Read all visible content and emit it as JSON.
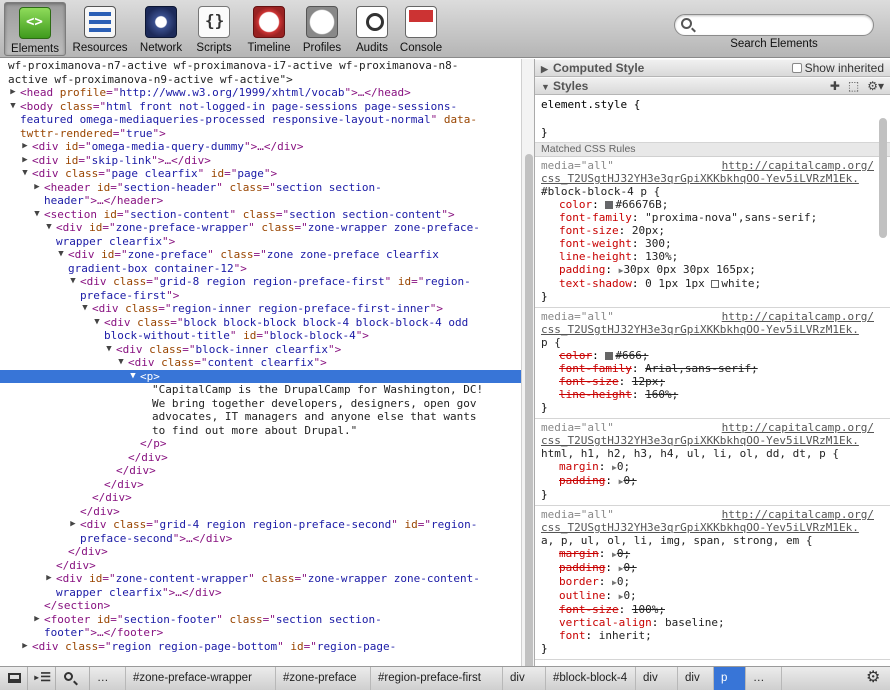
{
  "toolbar": {
    "tabs": [
      {
        "label": "Elements",
        "icon": "elements-icon",
        "selected": true
      },
      {
        "label": "Resources",
        "icon": "resources-icon"
      },
      {
        "label": "Network",
        "icon": "network-icon"
      },
      {
        "label": "Scripts",
        "icon": "scripts-icon"
      },
      {
        "label": "Timeline",
        "icon": "timeline-icon"
      },
      {
        "label": "Profiles",
        "icon": "profiles-icon"
      },
      {
        "label": "Audits",
        "icon": "audits-icon"
      },
      {
        "label": "Console",
        "icon": "console-icon"
      }
    ],
    "search_label": "Search Elements",
    "search_placeholder": ""
  },
  "dom_tree": [
    {
      "indent": 0,
      "tri": "",
      "parts": [
        [
          "tx",
          "wf-proximanova-n7-active wf-proximanova-i7-active wf-proximanova-n8-"
        ]
      ]
    },
    {
      "indent": 0,
      "tri": "",
      "parts": [
        [
          "tx",
          "active wf-proximanova-n9-active wf-active\">"
        ]
      ]
    },
    {
      "indent": 1,
      "tri": "▶",
      "parts": [
        [
          "tn",
          "<head "
        ],
        [
          "an",
          "profile"
        ],
        [
          "tn",
          "=\""
        ],
        [
          "av",
          "http://www.w3.org/1999/xhtml/vocab"
        ],
        [
          "tn",
          "\">…</head>"
        ]
      ]
    },
    {
      "indent": 1,
      "tri": "▼",
      "parts": [
        [
          "tn",
          "<body "
        ],
        [
          "an",
          "class"
        ],
        [
          "tn",
          "=\""
        ],
        [
          "av",
          "html front not-logged-in page-sessions page-sessions-"
        ]
      ]
    },
    {
      "indent": 1,
      "tri": "",
      "parts": [
        [
          "av",
          "featured omega-mediaqueries-processed responsive-layout-normal"
        ],
        [
          "tn",
          "\" "
        ],
        [
          "an",
          "data-"
        ]
      ]
    },
    {
      "indent": 1,
      "tri": "",
      "parts": [
        [
          "an",
          "twttr-rendered"
        ],
        [
          "tn",
          "=\""
        ],
        [
          "av",
          "true"
        ],
        [
          "tn",
          "\">"
        ]
      ]
    },
    {
      "indent": 2,
      "tri": "▶",
      "parts": [
        [
          "tn",
          "<div "
        ],
        [
          "an",
          "id"
        ],
        [
          "tn",
          "=\""
        ],
        [
          "av",
          "omega-media-query-dummy"
        ],
        [
          "tn",
          "\">…</div>"
        ]
      ]
    },
    {
      "indent": 2,
      "tri": "▶",
      "parts": [
        [
          "tn",
          "<div "
        ],
        [
          "an",
          "id"
        ],
        [
          "tn",
          "=\""
        ],
        [
          "av",
          "skip-link"
        ],
        [
          "tn",
          "\">…</div>"
        ]
      ]
    },
    {
      "indent": 2,
      "tri": "▼",
      "parts": [
        [
          "tn",
          "<div "
        ],
        [
          "an",
          "class"
        ],
        [
          "tn",
          "=\""
        ],
        [
          "av",
          "page clearfix"
        ],
        [
          "tn",
          "\" "
        ],
        [
          "an",
          "id"
        ],
        [
          "tn",
          "=\""
        ],
        [
          "av",
          "page"
        ],
        [
          "tn",
          "\">"
        ]
      ]
    },
    {
      "indent": 3,
      "tri": "▶",
      "parts": [
        [
          "tn",
          "<header "
        ],
        [
          "an",
          "id"
        ],
        [
          "tn",
          "=\""
        ],
        [
          "av",
          "section-header"
        ],
        [
          "tn",
          "\" "
        ],
        [
          "an",
          "class"
        ],
        [
          "tn",
          "=\""
        ],
        [
          "av",
          "section section-"
        ]
      ]
    },
    {
      "indent": 3,
      "tri": "",
      "parts": [
        [
          "av",
          "header"
        ],
        [
          "tn",
          "\">…</header>"
        ]
      ]
    },
    {
      "indent": 3,
      "tri": "▼",
      "parts": [
        [
          "tn",
          "<section "
        ],
        [
          "an",
          "id"
        ],
        [
          "tn",
          "=\""
        ],
        [
          "av",
          "section-content"
        ],
        [
          "tn",
          "\" "
        ],
        [
          "an",
          "class"
        ],
        [
          "tn",
          "=\""
        ],
        [
          "av",
          "section section-content"
        ],
        [
          "tn",
          "\">"
        ]
      ]
    },
    {
      "indent": 4,
      "tri": "▼",
      "parts": [
        [
          "tn",
          "<div "
        ],
        [
          "an",
          "id"
        ],
        [
          "tn",
          "=\""
        ],
        [
          "av",
          "zone-preface-wrapper"
        ],
        [
          "tn",
          "\" "
        ],
        [
          "an",
          "class"
        ],
        [
          "tn",
          "=\""
        ],
        [
          "av",
          "zone-wrapper zone-preface-"
        ]
      ]
    },
    {
      "indent": 4,
      "tri": "",
      "parts": [
        [
          "av",
          "wrapper clearfix"
        ],
        [
          "tn",
          "\">"
        ]
      ]
    },
    {
      "indent": 5,
      "tri": "▼",
      "parts": [
        [
          "tn",
          "<div "
        ],
        [
          "an",
          "id"
        ],
        [
          "tn",
          "=\""
        ],
        [
          "av",
          "zone-preface"
        ],
        [
          "tn",
          "\" "
        ],
        [
          "an",
          "class"
        ],
        [
          "tn",
          "=\""
        ],
        [
          "av",
          "zone zone-preface clearfix"
        ]
      ]
    },
    {
      "indent": 5,
      "tri": "",
      "parts": [
        [
          "av",
          "gradient-box container-12"
        ],
        [
          "tn",
          "\">"
        ]
      ]
    },
    {
      "indent": 6,
      "tri": "▼",
      "parts": [
        [
          "tn",
          "<div "
        ],
        [
          "an",
          "class"
        ],
        [
          "tn",
          "=\""
        ],
        [
          "av",
          "grid-8 region region-preface-first"
        ],
        [
          "tn",
          "\" "
        ],
        [
          "an",
          "id"
        ],
        [
          "tn",
          "=\""
        ],
        [
          "av",
          "region-"
        ]
      ]
    },
    {
      "indent": 6,
      "tri": "",
      "parts": [
        [
          "av",
          "preface-first"
        ],
        [
          "tn",
          "\">"
        ]
      ]
    },
    {
      "indent": 7,
      "tri": "▼",
      "parts": [
        [
          "tn",
          "<div "
        ],
        [
          "an",
          "class"
        ],
        [
          "tn",
          "=\""
        ],
        [
          "av",
          "region-inner region-preface-first-inner"
        ],
        [
          "tn",
          "\">"
        ]
      ]
    },
    {
      "indent": 8,
      "tri": "▼",
      "parts": [
        [
          "tn",
          "<div "
        ],
        [
          "an",
          "class"
        ],
        [
          "tn",
          "=\""
        ],
        [
          "av",
          "block block-block block-4 block-block-4 odd"
        ]
      ]
    },
    {
      "indent": 8,
      "tri": "",
      "parts": [
        [
          "av",
          "block-without-title"
        ],
        [
          "tn",
          "\" "
        ],
        [
          "an",
          "id"
        ],
        [
          "tn",
          "=\""
        ],
        [
          "av",
          "block-block-4"
        ],
        [
          "tn",
          "\">"
        ]
      ]
    },
    {
      "indent": 9,
      "tri": "▼",
      "parts": [
        [
          "tn",
          "<div "
        ],
        [
          "an",
          "class"
        ],
        [
          "tn",
          "=\""
        ],
        [
          "av",
          "block-inner clearfix"
        ],
        [
          "tn",
          "\">"
        ]
      ]
    },
    {
      "indent": 10,
      "tri": "▼",
      "parts": [
        [
          "tn",
          "<div "
        ],
        [
          "an",
          "class"
        ],
        [
          "tn",
          "=\""
        ],
        [
          "av",
          "content clearfix"
        ],
        [
          "tn",
          "\">"
        ]
      ]
    },
    {
      "indent": 11,
      "tri": "▼",
      "sel": true,
      "parts": [
        [
          "tn",
          "<p>"
        ]
      ]
    },
    {
      "indent": 12,
      "tri": "",
      "parts": [
        [
          "tx",
          "\"CapitalCamp is the DrupalCamp for Washington, DC!"
        ]
      ]
    },
    {
      "indent": 12,
      "tri": "",
      "parts": [
        [
          "tx",
          "We bring together developers, designers, open gov"
        ]
      ]
    },
    {
      "indent": 12,
      "tri": "",
      "parts": [
        [
          "tx",
          "advocates, IT managers and anyone else that wants"
        ]
      ]
    },
    {
      "indent": 12,
      "tri": "",
      "parts": [
        [
          "tx",
          "to find out more about Drupal.\""
        ]
      ]
    },
    {
      "indent": 11,
      "tri": "",
      "parts": [
        [
          "tn",
          "</p>"
        ]
      ]
    },
    {
      "indent": 10,
      "tri": "",
      "parts": [
        [
          "tn",
          "</div>"
        ]
      ]
    },
    {
      "indent": 9,
      "tri": "",
      "parts": [
        [
          "tn",
          "</div>"
        ]
      ]
    },
    {
      "indent": 8,
      "tri": "",
      "parts": [
        [
          "tn",
          "</div>"
        ]
      ]
    },
    {
      "indent": 7,
      "tri": "",
      "parts": [
        [
          "tn",
          "</div>"
        ]
      ]
    },
    {
      "indent": 6,
      "tri": "",
      "parts": [
        [
          "tn",
          "</div>"
        ]
      ]
    },
    {
      "indent": 6,
      "tri": "▶",
      "parts": [
        [
          "tn",
          "<div "
        ],
        [
          "an",
          "class"
        ],
        [
          "tn",
          "=\""
        ],
        [
          "av",
          "grid-4 region region-preface-second"
        ],
        [
          "tn",
          "\" "
        ],
        [
          "an",
          "id"
        ],
        [
          "tn",
          "=\""
        ],
        [
          "av",
          "region-"
        ]
      ]
    },
    {
      "indent": 6,
      "tri": "",
      "parts": [
        [
          "av",
          "preface-second"
        ],
        [
          "tn",
          "\">…</div>"
        ]
      ]
    },
    {
      "indent": 5,
      "tri": "",
      "parts": [
        [
          "tn",
          "</div>"
        ]
      ]
    },
    {
      "indent": 4,
      "tri": "",
      "parts": [
        [
          "tn",
          "</div>"
        ]
      ]
    },
    {
      "indent": 4,
      "tri": "▶",
      "parts": [
        [
          "tn",
          "<div "
        ],
        [
          "an",
          "id"
        ],
        [
          "tn",
          "=\""
        ],
        [
          "av",
          "zone-content-wrapper"
        ],
        [
          "tn",
          "\" "
        ],
        [
          "an",
          "class"
        ],
        [
          "tn",
          "=\""
        ],
        [
          "av",
          "zone-wrapper zone-content-"
        ]
      ]
    },
    {
      "indent": 4,
      "tri": "",
      "parts": [
        [
          "av",
          "wrapper clearfix"
        ],
        [
          "tn",
          "\">…</div>"
        ]
      ]
    },
    {
      "indent": 3,
      "tri": "",
      "parts": [
        [
          "tn",
          "</section>"
        ]
      ]
    },
    {
      "indent": 3,
      "tri": "▶",
      "parts": [
        [
          "tn",
          "<footer "
        ],
        [
          "an",
          "id"
        ],
        [
          "tn",
          "=\""
        ],
        [
          "av",
          "section-footer"
        ],
        [
          "tn",
          "\" "
        ],
        [
          "an",
          "class"
        ],
        [
          "tn",
          "=\""
        ],
        [
          "av",
          "section section-"
        ]
      ]
    },
    {
      "indent": 3,
      "tri": "",
      "parts": [
        [
          "av",
          "footer"
        ],
        [
          "tn",
          "\">…</footer>"
        ]
      ]
    },
    {
      "indent": 2,
      "tri": "▶",
      "parts": [
        [
          "tn",
          "<div "
        ],
        [
          "an",
          "class"
        ],
        [
          "tn",
          "=\""
        ],
        [
          "av",
          "region region-page-bottom"
        ],
        [
          "tn",
          "\" "
        ],
        [
          "an",
          "id"
        ],
        [
          "tn",
          "=\""
        ],
        [
          "av",
          "region-page-"
        ]
      ]
    }
  ],
  "sidebar": {
    "computed_style_title": "Computed Style",
    "show_inherited_label": "Show inherited",
    "styles_title": "Styles",
    "element_style_open": "element.style {",
    "element_style_close": "}",
    "matched_rules_title": "Matched CSS Rules",
    "rules": [
      {
        "media": "media=\"all\"",
        "source_host": "http://capitalcamp.org/",
        "source_path": "css_T2USgtHJ32YH3e3qrGpiXKKbkhqOO-Yev5iLVRzM1Ek.",
        "selector": "#block-block-4 p {",
        "props": [
          {
            "name": "color",
            "value": "#66676B;",
            "swatch": "#66676b"
          },
          {
            "name": "font-family",
            "value": "\"proxima-nova\",sans-serif;"
          },
          {
            "name": "font-size",
            "value": "20px;"
          },
          {
            "name": "font-weight",
            "value": "300;"
          },
          {
            "name": "line-height",
            "value": "130%;"
          },
          {
            "name": "padding",
            "value": "30px 0px 30px 165px;",
            "expand": true
          },
          {
            "name": "text-shadow",
            "value": "0 1px 1px ",
            "value2": "white;",
            "swatch2": "#ffffff"
          }
        ]
      },
      {
        "media": "media=\"all\"",
        "source_host": "http://capitalcamp.org/",
        "source_path": "css_T2USgtHJ32YH3e3qrGpiXKKbkhqOO-Yev5iLVRzM1Ek.",
        "selector": "p {",
        "props": [
          {
            "name": "color",
            "value": "#666;",
            "swatch": "#666666",
            "strike": true
          },
          {
            "name": "font-family",
            "value": "Arial,sans-serif;",
            "strike": true
          },
          {
            "name": "font-size",
            "value": "12px;",
            "strike": true
          },
          {
            "name": "line-height",
            "value": "160%;",
            "strike": true
          }
        ]
      },
      {
        "media": "media=\"all\"",
        "source_host": "http://capitalcamp.org/",
        "source_path": "css_T2USgtHJ32YH3e3qrGpiXKKbkhqOO-Yev5iLVRzM1Ek.",
        "selector": "html, h1, h2, h3, h4, ul, li, ol, dd, dt, p {",
        "props": [
          {
            "name": "margin",
            "value": "0;",
            "expand": true
          },
          {
            "name": "padding",
            "value": "0;",
            "expand": true,
            "strike": true
          }
        ]
      },
      {
        "media": "media=\"all\"",
        "source_host": "http://capitalcamp.org/",
        "source_path": "css_T2USgtHJ32YH3e3qrGpiXKKbkhqOO-Yev5iLVRzM1Ek.",
        "selector": "a, p, ul, ol, li, img, span, strong, em {",
        "props": [
          {
            "name": "margin",
            "value": "0;",
            "expand": true,
            "strike": true
          },
          {
            "name": "padding",
            "value": "0;",
            "expand": true,
            "strike": true
          },
          {
            "name": "border",
            "value": "0;",
            "expand": true
          },
          {
            "name": "outline",
            "value": "0;",
            "expand": true
          },
          {
            "name": "font-size",
            "value": "100%;",
            "strike": true
          },
          {
            "name": "vertical-align",
            "value": "baseline;"
          },
          {
            "name": "font",
            "value": "inherit;"
          }
        ]
      }
    ]
  },
  "status_bar": {
    "overflow_left": "…",
    "crumbs": [
      "#zone-preface-wrapper",
      "#zone-preface",
      "#region-preface-first",
      "div",
      "#block-block-4",
      "div",
      "div",
      "p"
    ],
    "overflow_right": "…",
    "active_crumb": "p"
  }
}
